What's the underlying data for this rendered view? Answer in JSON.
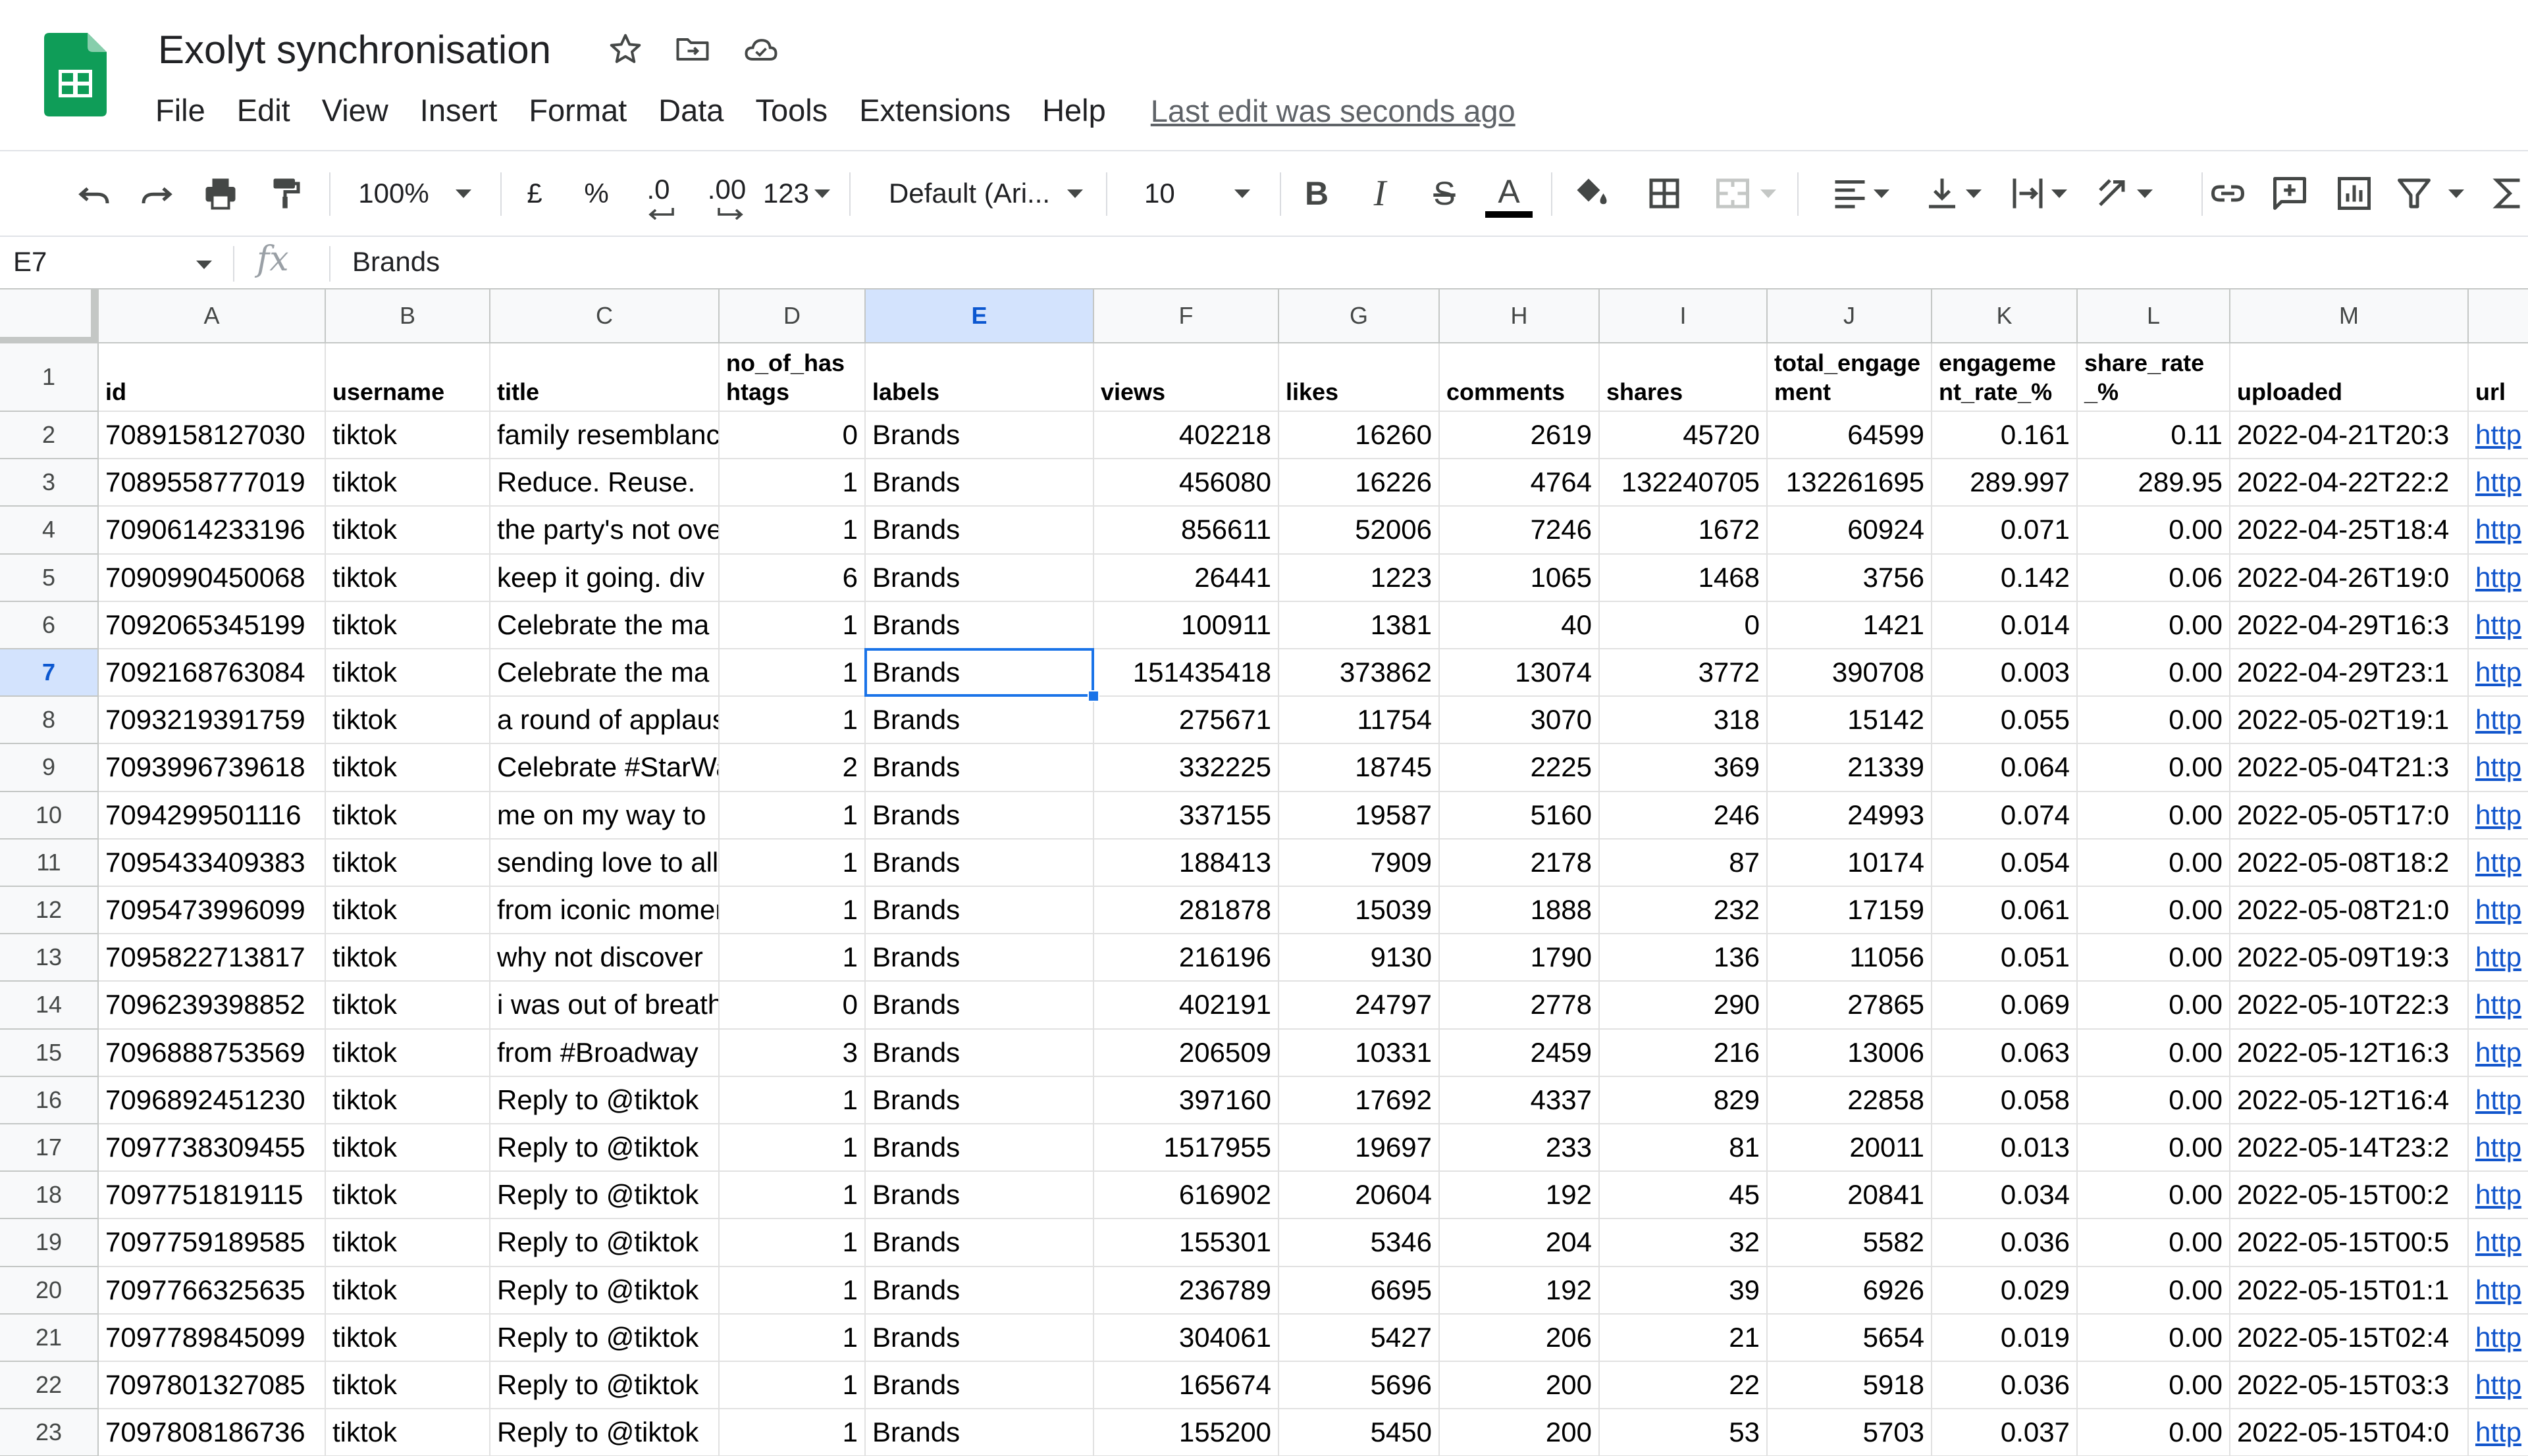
{
  "app": {
    "title": "Exolyt synchronisation",
    "last_edit": "Last edit was seconds ago"
  },
  "menu": [
    "File",
    "Edit",
    "View",
    "Insert",
    "Format",
    "Data",
    "Tools",
    "Extensions",
    "Help"
  ],
  "toolbar": {
    "zoom": "100%",
    "currency": "£",
    "percent": "%",
    "decimal_decrease": ".0",
    "decimal_increase": ".00",
    "number_format": "123",
    "font": "Default (Ari...",
    "font_size": "10",
    "bold": "B",
    "italic": "I",
    "strikethrough": "S",
    "text_color_letter": "A",
    "text_color": "#000000",
    "icons": [
      "undo-icon",
      "redo-icon",
      "print-icon",
      "paint-format-icon",
      "fill-color-icon",
      "borders-icon",
      "merge-cells-icon",
      "align-left-icon",
      "vertical-align-icon",
      "text-wrap-icon",
      "text-rotate-icon",
      "link-icon",
      "comment-icon",
      "chart-icon",
      "filter-icon",
      "functions-icon"
    ]
  },
  "formula_bar": {
    "cell_ref": "E7",
    "fx": "fx",
    "value": "Brands"
  },
  "grid": {
    "columns": [
      "A",
      "B",
      "C",
      "D",
      "E",
      "F",
      "G",
      "H",
      "I",
      "J",
      "K",
      "L",
      "M",
      ""
    ],
    "active_column": "E",
    "active_row": "7",
    "row_numbers": [
      "1",
      "2",
      "3",
      "4",
      "5",
      "6",
      "7",
      "8",
      "9",
      "10",
      "11",
      "12",
      "13",
      "14",
      "15",
      "16",
      "17",
      "18",
      "19",
      "20",
      "21",
      "22",
      "23"
    ],
    "header_row": [
      "id",
      "username",
      "title",
      "no_of_hashtags",
      "labels",
      "views",
      "likes",
      "comments",
      "shares",
      "total_engagement",
      "engagement_rate_%",
      "share_rate_%",
      "uploaded",
      "url"
    ],
    "rows": [
      [
        "7089158127030",
        "tiktok",
        "family resemblance",
        "0",
        "Brands",
        "402218",
        "16260",
        "2619",
        "45720",
        "64599",
        "0.161",
        "0.11",
        "2022-04-21T20:3",
        "http"
      ],
      [
        "7089558777019",
        "tiktok",
        "Reduce. Reuse.",
        "1",
        "Brands",
        "456080",
        "16226",
        "4764",
        "132240705",
        "132261695",
        "289.997",
        "289.95",
        "2022-04-22T22:2",
        "http"
      ],
      [
        "7090614233196",
        "tiktok",
        "the party's not over",
        "1",
        "Brands",
        "856611",
        "52006",
        "7246",
        "1672",
        "60924",
        "0.071",
        "0.00",
        "2022-04-25T18:4",
        "http"
      ],
      [
        "7090990450068",
        "tiktok",
        "keep it going. div",
        "6",
        "Brands",
        "26441",
        "1223",
        "1065",
        "1468",
        "3756",
        "0.142",
        "0.06",
        "2022-04-26T19:0",
        "http"
      ],
      [
        "7092065345199",
        "tiktok",
        "Celebrate the ma",
        "1",
        "Brands",
        "100911",
        "1381",
        "40",
        "0",
        "1421",
        "0.014",
        "0.00",
        "2022-04-29T16:3",
        "http"
      ],
      [
        "7092168763084",
        "tiktok",
        "Celebrate the ma",
        "1",
        "Brands",
        "151435418",
        "373862",
        "13074",
        "3772",
        "390708",
        "0.003",
        "0.00",
        "2022-04-29T23:1",
        "http"
      ],
      [
        "7093219391759",
        "tiktok",
        "a round of applause",
        "1",
        "Brands",
        "275671",
        "11754",
        "3070",
        "318",
        "15142",
        "0.055",
        "0.00",
        "2022-05-02T19:1",
        "http"
      ],
      [
        "7093996739618",
        "tiktok",
        "Celebrate #StarWars",
        "2",
        "Brands",
        "332225",
        "18745",
        "2225",
        "369",
        "21339",
        "0.064",
        "0.00",
        "2022-05-04T21:3",
        "http"
      ],
      [
        "7094299501116",
        "tiktok",
        "me on my way to",
        "1",
        "Brands",
        "337155",
        "19587",
        "5160",
        "246",
        "24993",
        "0.074",
        "0.00",
        "2022-05-05T17:0",
        "http"
      ],
      [
        "7095433409383",
        "tiktok",
        "sending love to all",
        "1",
        "Brands",
        "188413",
        "7909",
        "2178",
        "87",
        "10174",
        "0.054",
        "0.00",
        "2022-05-08T18:2",
        "http"
      ],
      [
        "7095473996099",
        "tiktok",
        "from iconic moments",
        "1",
        "Brands",
        "281878",
        "15039",
        "1888",
        "232",
        "17159",
        "0.061",
        "0.00",
        "2022-05-08T21:0",
        "http"
      ],
      [
        "7095822713817",
        "tiktok",
        "why not discover",
        "1",
        "Brands",
        "216196",
        "9130",
        "1790",
        "136",
        "11056",
        "0.051",
        "0.00",
        "2022-05-09T19:3",
        "http"
      ],
      [
        "7096239398852",
        "tiktok",
        "i was out of breath",
        "0",
        "Brands",
        "402191",
        "24797",
        "2778",
        "290",
        "27865",
        "0.069",
        "0.00",
        "2022-05-10T22:3",
        "http"
      ],
      [
        "7096888753569",
        "tiktok",
        "from #Broadway",
        "3",
        "Brands",
        "206509",
        "10331",
        "2459",
        "216",
        "13006",
        "0.063",
        "0.00",
        "2022-05-12T16:3",
        "http"
      ],
      [
        "7096892451230",
        "tiktok",
        "Reply to @tiktok",
        "1",
        "Brands",
        "397160",
        "17692",
        "4337",
        "829",
        "22858",
        "0.058",
        "0.00",
        "2022-05-12T16:4",
        "http"
      ],
      [
        "7097738309455",
        "tiktok",
        "Reply to @tiktok",
        "1",
        "Brands",
        "1517955",
        "19697",
        "233",
        "81",
        "20011",
        "0.013",
        "0.00",
        "2022-05-14T23:2",
        "http"
      ],
      [
        "7097751819115",
        "tiktok",
        "Reply to @tiktok",
        "1",
        "Brands",
        "616902",
        "20604",
        "192",
        "45",
        "20841",
        "0.034",
        "0.00",
        "2022-05-15T00:2",
        "http"
      ],
      [
        "7097759189585",
        "tiktok",
        "Reply to @tiktok",
        "1",
        "Brands",
        "155301",
        "5346",
        "204",
        "32",
        "5582",
        "0.036",
        "0.00",
        "2022-05-15T00:5",
        "http"
      ],
      [
        "7097766325635",
        "tiktok",
        "Reply to @tiktok",
        "1",
        "Brands",
        "236789",
        "6695",
        "192",
        "39",
        "6926",
        "0.029",
        "0.00",
        "2022-05-15T01:1",
        "http"
      ],
      [
        "7097789845099",
        "tiktok",
        "Reply to @tiktok",
        "1",
        "Brands",
        "304061",
        "5427",
        "206",
        "21",
        "5654",
        "0.019",
        "0.00",
        "2022-05-15T02:4",
        "http"
      ],
      [
        "7097801327085",
        "tiktok",
        "Reply to @tiktok",
        "1",
        "Brands",
        "165674",
        "5696",
        "200",
        "22",
        "5918",
        "0.036",
        "0.00",
        "2022-05-15T03:3",
        "http"
      ],
      [
        "7097808186736",
        "tiktok",
        "Reply to @tiktok",
        "1",
        "Brands",
        "155200",
        "5450",
        "200",
        "53",
        "5703",
        "0.037",
        "0.00",
        "2022-05-15T04:0",
        "http"
      ]
    ]
  }
}
